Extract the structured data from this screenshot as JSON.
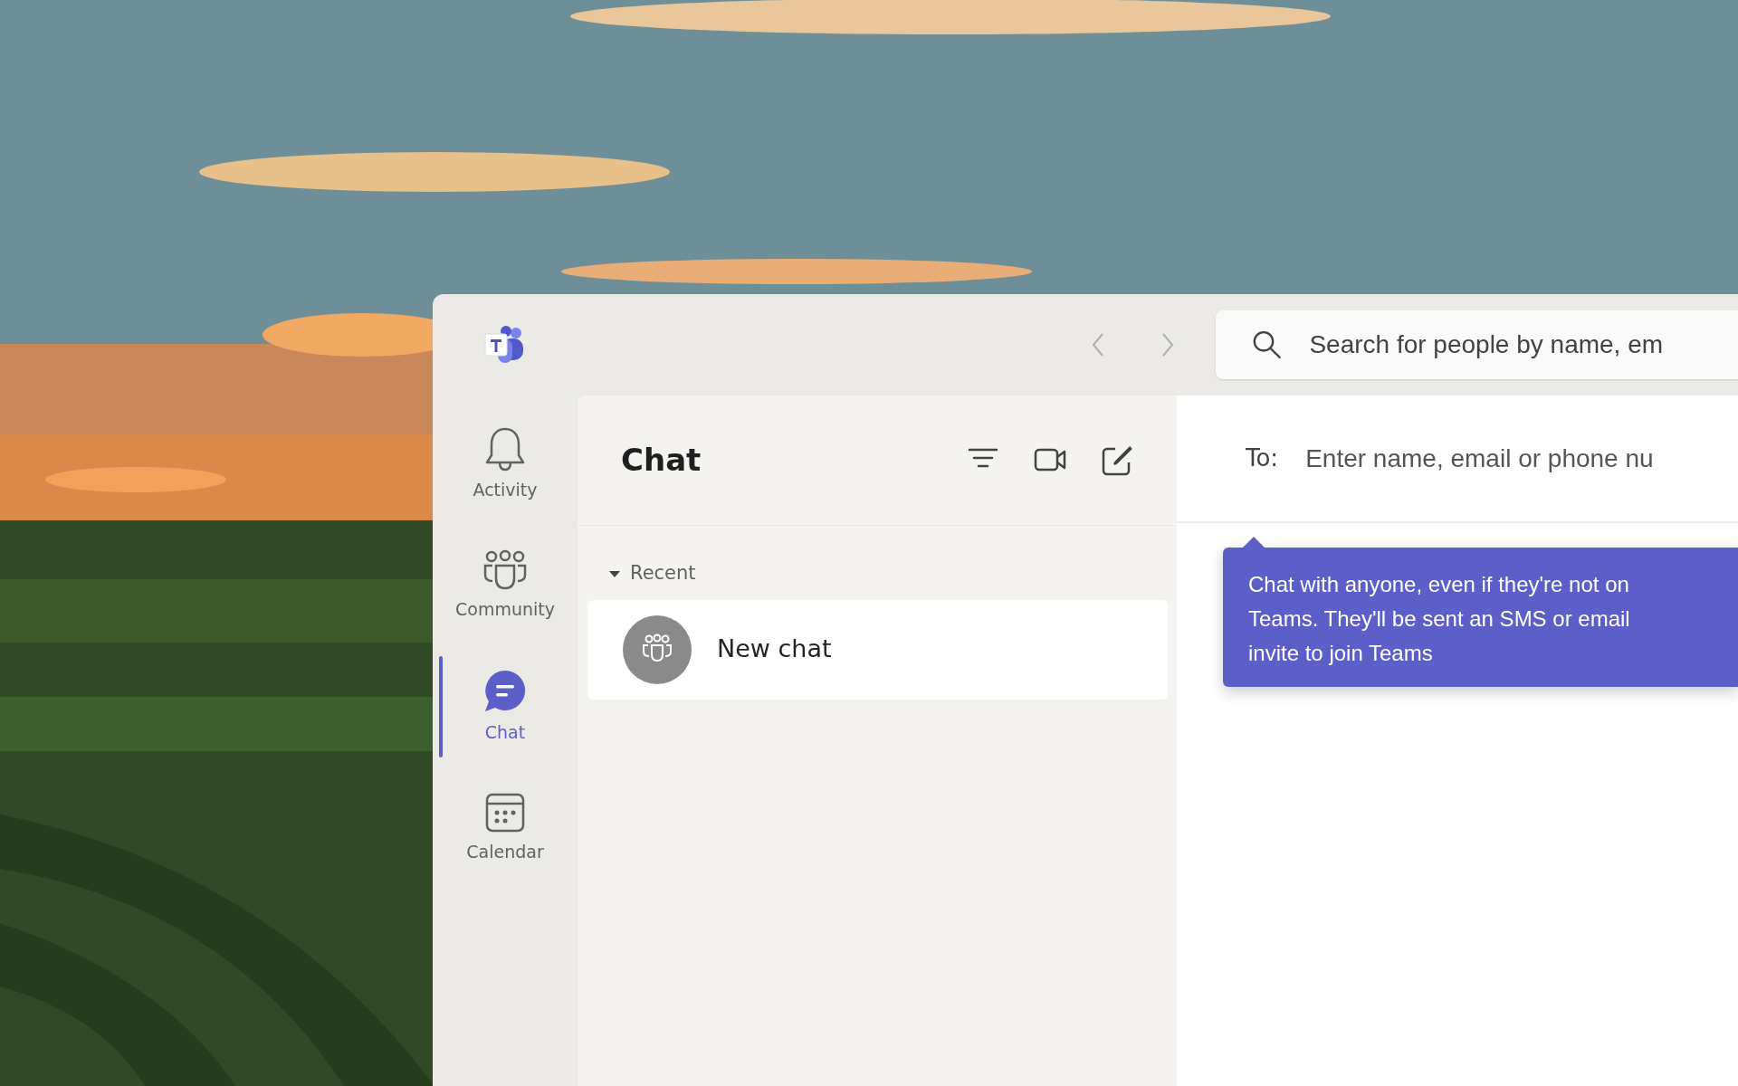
{
  "title_bar": {
    "search": {
      "placeholder": "Search for people by name, em"
    }
  },
  "rail": {
    "items": [
      {
        "label": "Activity",
        "kind": "bell",
        "selected": false
      },
      {
        "label": "Community",
        "kind": "people",
        "selected": false
      },
      {
        "label": "Chat",
        "kind": "chat",
        "selected": true
      },
      {
        "label": "Calendar",
        "kind": "calendar",
        "selected": false
      }
    ]
  },
  "chat_list": {
    "title": "Chat",
    "section": {
      "label": "Recent",
      "expanded": true
    },
    "items": [
      {
        "name": "New chat",
        "selected": true
      }
    ]
  },
  "compose": {
    "to_label": "To:",
    "placeholder": "Enter name, email or phone nu"
  },
  "tooltip": {
    "text": "Chat with anyone, even if they're not on Teams. They'll be sent an SMS or email invite to join Teams"
  }
}
